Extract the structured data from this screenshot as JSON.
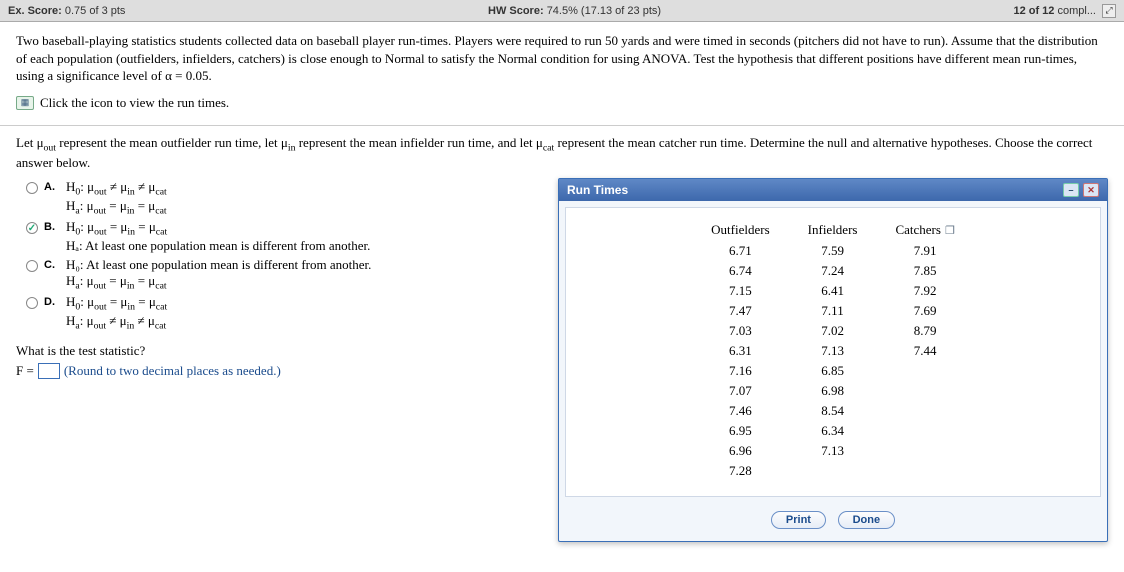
{
  "topbar": {
    "ex_label": "Ex. Score:",
    "ex_value": "0.75 of 3 pts",
    "hw_label": "HW Score:",
    "hw_value": "74.5% (17.13 of 23 pts)",
    "progress": "12 of 12",
    "progress_suffix": " compl..."
  },
  "question": {
    "body": "Two baseball-playing statistics students collected data on baseball player run-times. Players were required to run 50 yards and were timed in seconds (pitchers did not have to run). Assume that the distribution of each population (outfielders, infielders, catchers) is close enough to Normal to satisfy the Normal condition for using ANOVA. Test the hypothesis that different positions have different mean run-times, using a significance level of α = 0.05.",
    "link": "Click the icon to view the run times."
  },
  "prompt": {
    "pre": "Let μ",
    "sub1": "out",
    "mid1": " represent the mean outfielder run time, let μ",
    "sub2": "in",
    "mid2": " represent the mean infielder run time, and let μ",
    "sub3": "cat",
    "mid3": " represent the mean catcher run time. Determine the null and alternative hypotheses. Choose the correct answer below."
  },
  "options": {
    "a": {
      "label": "A.",
      "h0": "H₀: μout ≠ μin ≠ μcat",
      "ha": "Hₐ: μout = μin = μcat"
    },
    "b": {
      "label": "B.",
      "h0": "H₀: μout = μin = μcat",
      "ha": "Hₐ: At least one population mean is different from another."
    },
    "c": {
      "label": "C.",
      "h0": "H₀: At least one population mean is different from another.",
      "ha": "Hₐ: μout = μin = μcat"
    },
    "d": {
      "label": "D.",
      "h0": "H₀: μout = μin = μcat",
      "ha": "Hₐ: μout ≠ μin ≠ μcat"
    }
  },
  "stat_q": "What is the test statistic?",
  "f_row": {
    "prefix": "F =",
    "hint": "(Round to two decimal places as needed.)"
  },
  "popup": {
    "title": "Run Times",
    "headers": [
      "Outfielders",
      "Infielders",
      "Catchers"
    ],
    "rows": [
      [
        "6.71",
        "7.59",
        "7.91"
      ],
      [
        "6.74",
        "7.24",
        "7.85"
      ],
      [
        "7.15",
        "6.41",
        "7.92"
      ],
      [
        "7.47",
        "7.11",
        "7.69"
      ],
      [
        "7.03",
        "7.02",
        "8.79"
      ],
      [
        "6.31",
        "7.13",
        "7.44"
      ],
      [
        "7.16",
        "6.85",
        ""
      ],
      [
        "7.07",
        "6.98",
        ""
      ],
      [
        "7.46",
        "8.54",
        ""
      ],
      [
        "6.95",
        "6.34",
        ""
      ],
      [
        "6.96",
        "7.13",
        ""
      ],
      [
        "7.28",
        "",
        ""
      ]
    ],
    "print": "Print",
    "done": "Done"
  },
  "chart_data": {
    "type": "table",
    "title": "Run Times",
    "columns": [
      "Outfielders",
      "Infielders",
      "Catchers"
    ],
    "data": {
      "Outfielders": [
        6.71,
        6.74,
        7.15,
        7.47,
        7.03,
        6.31,
        7.16,
        7.07,
        7.46,
        6.95,
        6.96,
        7.28
      ],
      "Infielders": [
        7.59,
        7.24,
        6.41,
        7.11,
        7.02,
        7.13,
        6.85,
        6.98,
        8.54,
        6.34,
        7.13
      ],
      "Catchers": [
        7.91,
        7.85,
        7.92,
        7.69,
        8.79,
        7.44
      ]
    }
  }
}
